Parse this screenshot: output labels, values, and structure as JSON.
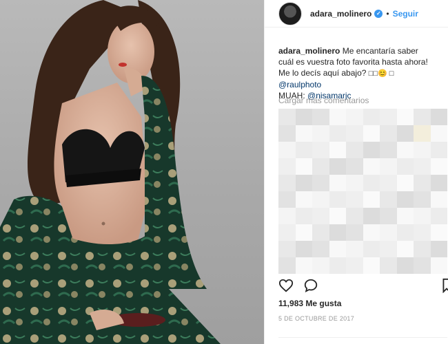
{
  "header": {
    "username": "adara_molinero",
    "separator": "•",
    "follow_label": "Seguir"
  },
  "caption": {
    "username": "adara_molinero",
    "text": "Me encantaría saber cuál es vuestra foto favorita hasta ahora! Me lo decís aquí abajo?",
    "emoji": "□□😊 □",
    "mention1": "@raulphoto",
    "muah_label": "MUAH:",
    "mention2": "@nisamarjc"
  },
  "load_more": "Cargar más comentarios",
  "likes": "11,983 Me gusta",
  "date": "5 DE OCTUBRE DE 2017",
  "icons": [
    "heart-icon",
    "comment-icon",
    "bookmark-icon",
    "verified-icon"
  ],
  "colors": {
    "accent": "#3897f0",
    "link": "#003569",
    "muted": "#999999",
    "text": "#262626"
  }
}
